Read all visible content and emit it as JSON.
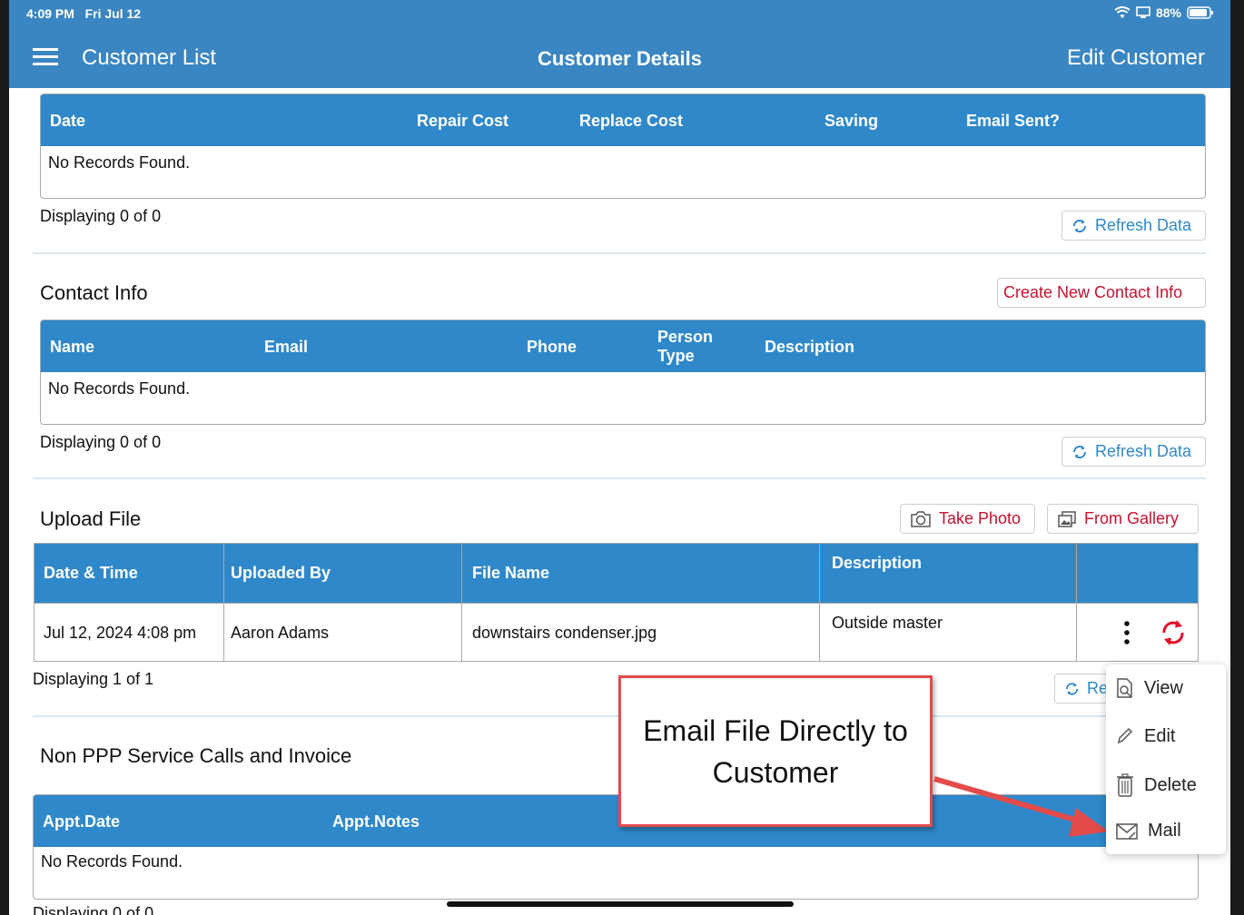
{
  "status_bar": {
    "time": "4:09 PM",
    "date": "Fri Jul 12",
    "battery": "88%"
  },
  "nav": {
    "left_label": "Customer List",
    "title": "Customer Details",
    "right_label": "Edit Customer"
  },
  "savings_table": {
    "headers": [
      "Date",
      "Repair Cost",
      "Replace Cost",
      "Saving",
      "Email Sent?"
    ],
    "empty_message": "No Records Found.",
    "display_text": "Displaying 0 of 0",
    "refresh_label": "Refresh Data"
  },
  "contact_info": {
    "title": "Contact Info",
    "create_label": "Create New Contact Info",
    "headers": [
      "Name",
      "Email",
      "Phone",
      "Person Type",
      "Description"
    ],
    "empty_message": "No Records Found.",
    "display_text": "Displaying 0 of 0",
    "refresh_label": "Refresh Data"
  },
  "upload_file": {
    "title": "Upload File",
    "take_photo_label": "Take Photo",
    "from_gallery_label": "From Gallery",
    "headers": [
      "Date & Time",
      "Uploaded By",
      "File Name",
      "Description"
    ],
    "rows": [
      {
        "date_time": "Jul 12, 2024 4:08 pm",
        "uploaded_by": "Aaron Adams",
        "file_name": "downstairs condenser.jpg",
        "description": "Outside master"
      }
    ],
    "display_text": "Displaying 1 of 1",
    "refresh_partial": "Re"
  },
  "action_menu": {
    "items": [
      "View",
      "Edit",
      "Delete",
      "Mail"
    ]
  },
  "service_calls": {
    "title": "Non PPP Service Calls and Invoice",
    "headers": [
      "Appt.Date",
      "Appt.Notes"
    ],
    "empty_message": "No Records Found.",
    "display_text": "Displaying 0 of 0"
  },
  "callout": {
    "text": "Email File Directly to Customer",
    "border_color": "#e34b4b"
  },
  "colors": {
    "header_blue": "#3a86c2",
    "table_blue": "#2f88c9",
    "accent_red": "#c41230"
  }
}
